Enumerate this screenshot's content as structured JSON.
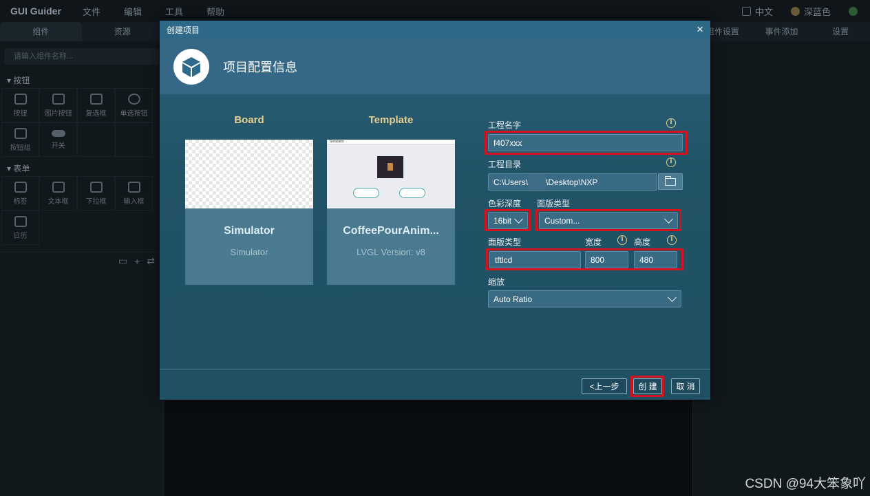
{
  "app": {
    "title": "GUI Guider",
    "menu": [
      "文件",
      "编辑",
      "工具",
      "帮助"
    ],
    "language": "中文",
    "theme": "深蓝色"
  },
  "left_panel": {
    "tabs": [
      "组件",
      "资源"
    ],
    "search_placeholder": "请输入组件名称...",
    "sections": [
      {
        "title": "按钮",
        "items": [
          "按钮",
          "图片按钮",
          "复选框",
          "单选按钮",
          "按钮组",
          "开关"
        ]
      },
      {
        "title": "表单",
        "items": [
          "标签",
          "文本框",
          "下拉框",
          "输入框",
          "日历"
        ]
      }
    ]
  },
  "right_panel": {
    "tabs": [
      "组件设置",
      "事件添加",
      "设置"
    ]
  },
  "dialog": {
    "window_title": "创建项目",
    "close_glyph": "×",
    "heading": "项目配置信息",
    "board": {
      "column_title": "Board",
      "name": "Simulator",
      "subtitle": "Simulator"
    },
    "template": {
      "column_title": "Template",
      "name": "CoffeePourAnim...",
      "subtitle": "LVGL Version: v8",
      "thumb_title": "Simulator"
    },
    "form": {
      "project_name_label": "工程名字",
      "project_name_value": "f407xxx",
      "project_dir_label": "工程目录",
      "project_dir_prefix": "C:\\Users\\",
      "project_dir_suffix": "\\Desktop\\NXP",
      "color_depth_label": "色彩深度",
      "color_depth_value": "16bit",
      "panel_type_label": "面版类型",
      "panel_type_value": "Custom...",
      "panel_type2_label": "面版类型",
      "panel_type2_value": "tftlcd",
      "width_label": "宽度",
      "width_value": "800",
      "height_label": "高度",
      "height_value": "480",
      "scale_label": "缩放",
      "scale_value": "Auto Ratio"
    },
    "buttons": {
      "back": "<上一步",
      "create": "创 建",
      "cancel": "取 消"
    },
    "highlight_color": "#d6121e"
  },
  "watermark": "CSDN @94大笨象吖"
}
